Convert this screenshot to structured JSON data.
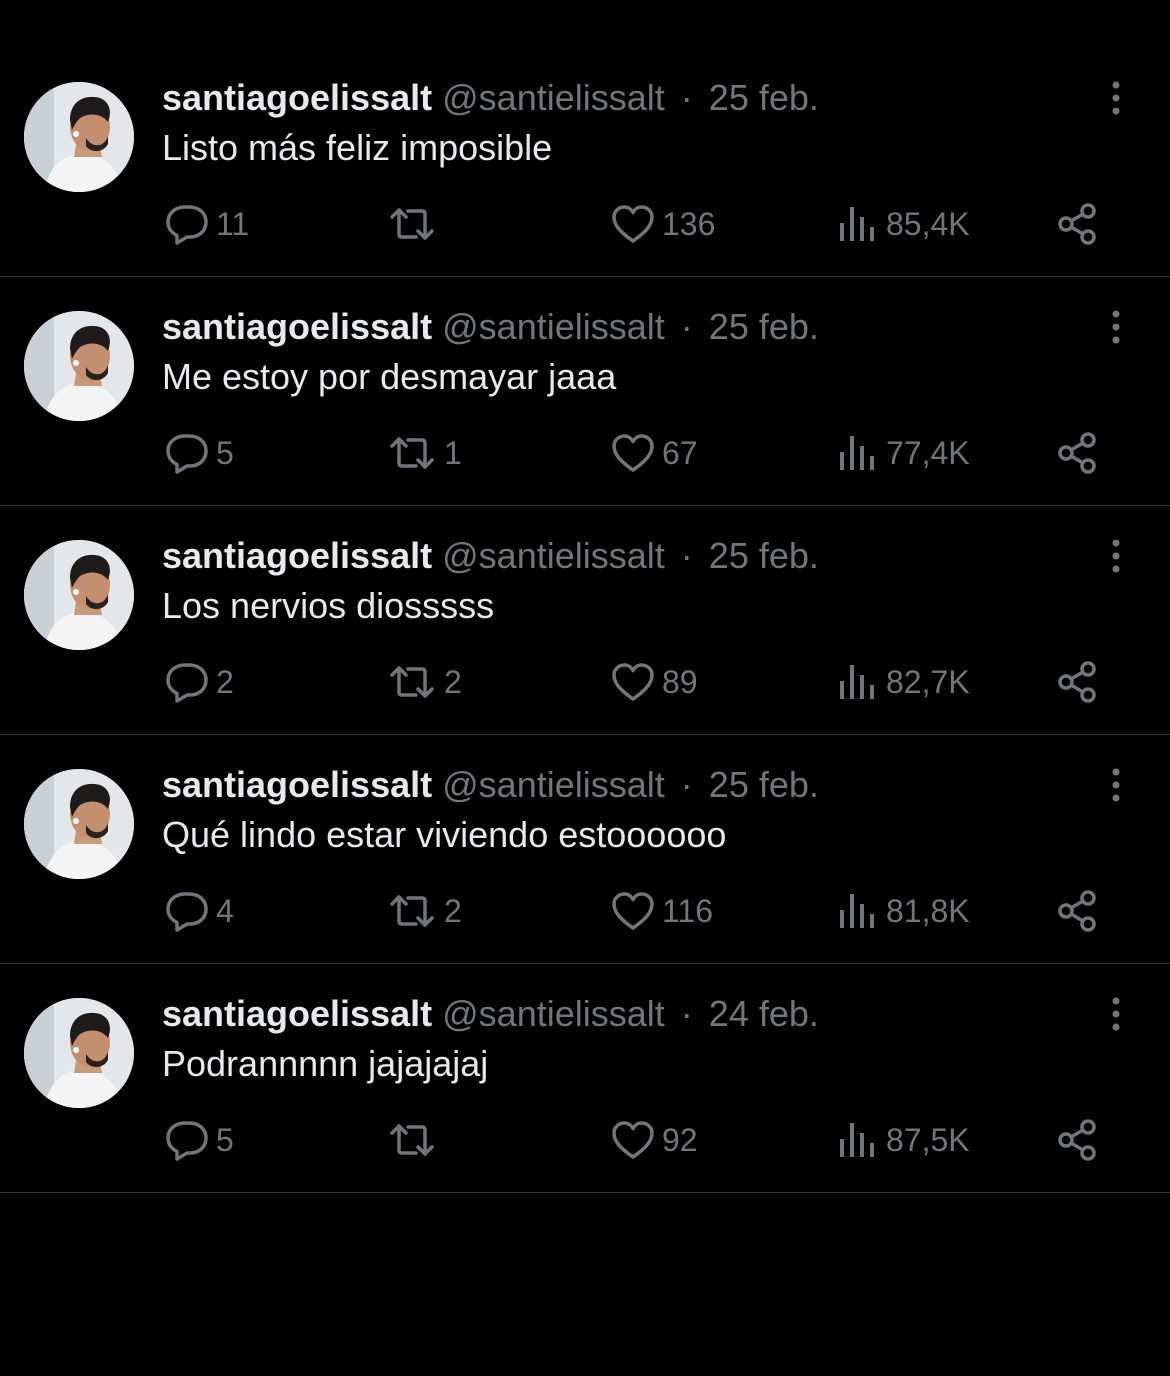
{
  "colors": {
    "background": "#000000",
    "primary_text": "#e7e9ea",
    "secondary_text": "#71767b",
    "divider": "#2f3336"
  },
  "icons": {
    "reply": "speech-bubble",
    "retweet": "retweet-arrows",
    "like": "heart",
    "views": "bar-chart",
    "share": "share-nodes",
    "more": "vertical-ellipsis"
  },
  "tweets": [
    {
      "name": "santiagoelissalt",
      "handle": "@santielissalt",
      "separator": "·",
      "date": "25 feb.",
      "text": "Listo más feliz imposible",
      "replies": "11",
      "retweets": "",
      "likes": "136",
      "views": "85,4K"
    },
    {
      "name": "santiagoelissalt",
      "handle": "@santielissalt",
      "separator": "·",
      "date": "25 feb.",
      "text": "Me estoy por desmayar jaaa",
      "replies": "5",
      "retweets": "1",
      "likes": "67",
      "views": "77,4K"
    },
    {
      "name": "santiagoelissalt",
      "handle": "@santielissalt",
      "separator": "·",
      "date": "25 feb.",
      "text": "Los nervios diosssss",
      "replies": "2",
      "retweets": "2",
      "likes": "89",
      "views": "82,7K"
    },
    {
      "name": "santiagoelissalt",
      "handle": "@santielissalt",
      "separator": "·",
      "date": "25 feb.",
      "text": "Qué lindo estar viviendo estoooooo",
      "replies": "4",
      "retweets": "2",
      "likes": "116",
      "views": "81,8K"
    },
    {
      "name": "santiagoelissalt",
      "handle": "@santielissalt",
      "separator": "·",
      "date": "24 feb.",
      "text": "Podrannnnn jajajajaj",
      "replies": "5",
      "retweets": "",
      "likes": "92",
      "views": "87,5K"
    }
  ]
}
